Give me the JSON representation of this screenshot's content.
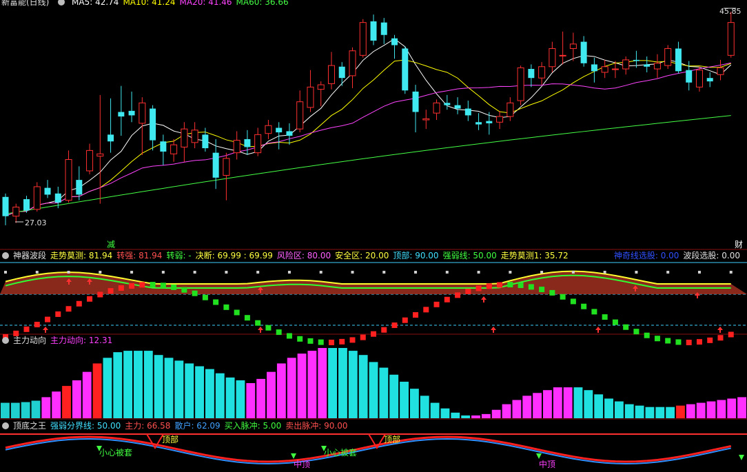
{
  "main": {
    "title": "新富能(日线)",
    "ma": [
      {
        "label": "MA5: 42.74",
        "color": "#ffffff"
      },
      {
        "label": "MA10: 41.24",
        "color": "#ffff00"
      },
      {
        "label": "MA20: 41.46",
        "color": "#ff44ff"
      },
      {
        "label": "MA60: 36.66",
        "color": "#44ff44"
      }
    ],
    "high_label": "45.85",
    "low_label": "27.03",
    "mark_left": "减",
    "mark_right": "财"
  },
  "panels": [
    {
      "title": "神器波段",
      "items": [
        {
          "text": "走势莫测: 81.94",
          "color": "#ffff40"
        },
        {
          "text": "转强: 81.94",
          "color": "#ff5050"
        },
        {
          "text": "转弱: -",
          "color": "#40ff40"
        },
        {
          "text": "决断: 69.99 : 69.99",
          "color": "#ffff40"
        },
        {
          "text": "风险区: 80.00",
          "color": "#ff60ff"
        },
        {
          "text": "安全区: 20.00",
          "color": "#ffff40"
        },
        {
          "text": "顶部: 90.00",
          "color": "#40e0ff"
        },
        {
          "text": "强弱线: 50.00",
          "color": "#40ff40"
        },
        {
          "text": "走势莫测1: 35.72",
          "color": "#ffff40"
        }
      ],
      "right_items": [
        {
          "text": "神奇线选股: 0.00",
          "color": "#3050ff"
        },
        {
          "text": "波段选股: 0.00",
          "color": "#e0e0e0"
        }
      ]
    },
    {
      "title": "主力动向",
      "items": [
        {
          "text": "主力动向: 12.31",
          "color": "#ff40ff"
        }
      ],
      "right_items": []
    },
    {
      "title": "顶底之王",
      "items": [
        {
          "text": "强弱分界线: 50.00",
          "color": "#40e0ff"
        },
        {
          "text": "主力: 66.58",
          "color": "#ff5050"
        },
        {
          "text": "散户: 62.09",
          "color": "#40a0ff"
        },
        {
          "text": "买入脉冲: 5.00",
          "color": "#40ff40"
        },
        {
          "text": "卖出脉冲: 90.00",
          "color": "#ff5050"
        }
      ],
      "right_items": []
    }
  ],
  "annotations": {
    "top_label": "顶部",
    "trap_label": "小心被套",
    "mid_top_label": "中顶"
  },
  "chart_data": [
    {
      "type": "candlestick",
      "name": "新富能(日线)",
      "x": [
        1,
        2,
        3,
        4,
        5,
        6,
        7,
        8,
        9,
        10,
        11,
        12,
        13,
        14,
        15,
        16,
        17,
        18,
        19,
        20,
        21,
        22,
        23,
        24,
        25,
        26,
        27,
        28,
        29,
        30,
        31,
        32,
        33,
        34,
        35,
        36,
        37,
        38,
        39,
        40,
        41,
        42,
        43,
        44,
        45,
        46,
        47,
        48,
        49,
        50,
        51,
        52,
        53,
        54,
        55,
        56,
        57,
        58,
        59,
        60,
        61,
        62,
        63,
        64,
        65,
        66,
        67,
        68,
        69,
        70
      ],
      "ohlc": [
        [
          29.5,
          29.8,
          27.0,
          27.8
        ],
        [
          27.8,
          28.9,
          27.2,
          28.6
        ],
        [
          29.3,
          29.6,
          28.1,
          28.3
        ],
        [
          28.4,
          30.8,
          28.2,
          30.4
        ],
        [
          30.3,
          31.0,
          29.4,
          29.7
        ],
        [
          29.8,
          30.4,
          28.5,
          29.0
        ],
        [
          29.2,
          33.6,
          29.0,
          32.8
        ],
        [
          31.0,
          32.2,
          29.2,
          29.7
        ],
        [
          31.8,
          34.2,
          31.5,
          33.6
        ],
        [
          33.1,
          38.5,
          28.9,
          33.3
        ],
        [
          35.0,
          38.2,
          33.4,
          34.4
        ],
        [
          37.0,
          39.3,
          34.9,
          36.6
        ],
        [
          37.1,
          38.8,
          36.1,
          36.7
        ],
        [
          36.0,
          38.3,
          33.2,
          37.8
        ],
        [
          37.3,
          37.6,
          33.6,
          34.5
        ],
        [
          34.4,
          35.0,
          32.3,
          33.5
        ],
        [
          33.3,
          34.6,
          32.6,
          34.1
        ],
        [
          33.9,
          36.1,
          32.6,
          35.5
        ],
        [
          34.3,
          36.1,
          33.8,
          35.4
        ],
        [
          35.0,
          35.6,
          33.5,
          33.8
        ],
        [
          33.4,
          34.6,
          30.2,
          31.2
        ],
        [
          31.4,
          33.4,
          29.2,
          32.9
        ],
        [
          33.4,
          35.3,
          32.8,
          34.5
        ],
        [
          34.6,
          35.4,
          33.2,
          33.9
        ],
        [
          33.4,
          35.6,
          33.1,
          35.0
        ],
        [
          35.1,
          36.3,
          34.6,
          35.8
        ],
        [
          35.6,
          36.1,
          33.7,
          35.2
        ],
        [
          35.3,
          36.0,
          34.1,
          34.9
        ],
        [
          35.5,
          38.9,
          35.2,
          37.9
        ],
        [
          37.4,
          40.7,
          37.0,
          39.2
        ],
        [
          39.0,
          39.7,
          37.5,
          39.4
        ],
        [
          39.5,
          42.3,
          39.0,
          41.1
        ],
        [
          41.0,
          41.4,
          39.3,
          40.0
        ],
        [
          40.2,
          42.7,
          39.1,
          42.4
        ],
        [
          42.0,
          45.2,
          41.8,
          44.9
        ],
        [
          45.0,
          45.6,
          42.9,
          43.3
        ],
        [
          44.9,
          45.3,
          43.0,
          43.8
        ],
        [
          43.5,
          43.8,
          41.7,
          42.9
        ],
        [
          42.6,
          42.8,
          38.6,
          38.9
        ],
        [
          38.8,
          39.4,
          35.2,
          37.0
        ],
        [
          36.3,
          37.2,
          35.5,
          36.4
        ],
        [
          36.9,
          38.1,
          36.3,
          37.8
        ],
        [
          37.8,
          38.5,
          37.2,
          37.6
        ],
        [
          37.6,
          38.3,
          36.8,
          37.3
        ],
        [
          37.3,
          38.0,
          36.2,
          36.7
        ],
        [
          36.1,
          36.9,
          35.4,
          35.9
        ],
        [
          36.2,
          37.0,
          35.0,
          36.0
        ],
        [
          36.1,
          37.1,
          35.5,
          36.6
        ],
        [
          36.6,
          38.3,
          36.2,
          37.8
        ],
        [
          38.0,
          41.1,
          37.6,
          40.9
        ],
        [
          40.8,
          41.2,
          39.2,
          40.0
        ],
        [
          40.0,
          41.4,
          39.4,
          41.0
        ],
        [
          41.0,
          43.2,
          40.5,
          42.6
        ],
        [
          42.0,
          44.1,
          41.2,
          42.0
        ],
        [
          42.6,
          44.0,
          41.5,
          43.0
        ],
        [
          43.2,
          43.7,
          41.0,
          41.3
        ],
        [
          41.2,
          41.8,
          39.6,
          40.6
        ],
        [
          40.5,
          41.6,
          40.0,
          41.0
        ],
        [
          40.8,
          41.5,
          40.0,
          40.8
        ],
        [
          40.8,
          41.9,
          40.3,
          41.6
        ],
        [
          41.6,
          42.4,
          40.9,
          41.5
        ],
        [
          41.2,
          41.9,
          40.5,
          41.0
        ],
        [
          40.8,
          42.1,
          40.0,
          41.3
        ],
        [
          41.1,
          42.9,
          40.8,
          42.6
        ],
        [
          42.6,
          43.2,
          40.4,
          40.6
        ],
        [
          40.7,
          41.5,
          38.9,
          39.6
        ],
        [
          39.2,
          41.0,
          38.8,
          40.7
        ],
        [
          40.0,
          40.5,
          39.2,
          39.7
        ],
        [
          40.3,
          41.6,
          39.8,
          40.9
        ],
        [
          42.0,
          45.85,
          41.8,
          44.9
        ]
      ],
      "ma": [
        "MA5",
        "MA10",
        "MA20",
        "MA60"
      ],
      "high": 45.85,
      "low": 27.03
    },
    {
      "type": "line",
      "name": "神器波段",
      "risk_zone": 80.0,
      "safe_zone": 20.0,
      "top": 90.0,
      "strength_line": 50.0
    },
    {
      "type": "bar",
      "name": "主力动向",
      "values": [
        22,
        22,
        23,
        25,
        30,
        38,
        46,
        54,
        66,
        78,
        86,
        94,
        96,
        96,
        96,
        90,
        86,
        82,
        78,
        74,
        70,
        64,
        58,
        54,
        50,
        56,
        66,
        78,
        86,
        92,
        96,
        100,
        100,
        100,
        96,
        90,
        80,
        72,
        62,
        52,
        42,
        32,
        22,
        14,
        8,
        4,
        4,
        6,
        12,
        20,
        26,
        32,
        36,
        40,
        44,
        44,
        44,
        40,
        34,
        28,
        24,
        20,
        18,
        16,
        16,
        16,
        18,
        20,
        22,
        24,
        26,
        28,
        30
      ],
      "last_value": 12.31
    },
    {
      "type": "line",
      "name": "顶底之王",
      "boundary": 50.0,
      "main_force": 66.58,
      "retail": 62.09,
      "buy_pulse": 5.0,
      "sell_pulse": 90.0
    }
  ]
}
